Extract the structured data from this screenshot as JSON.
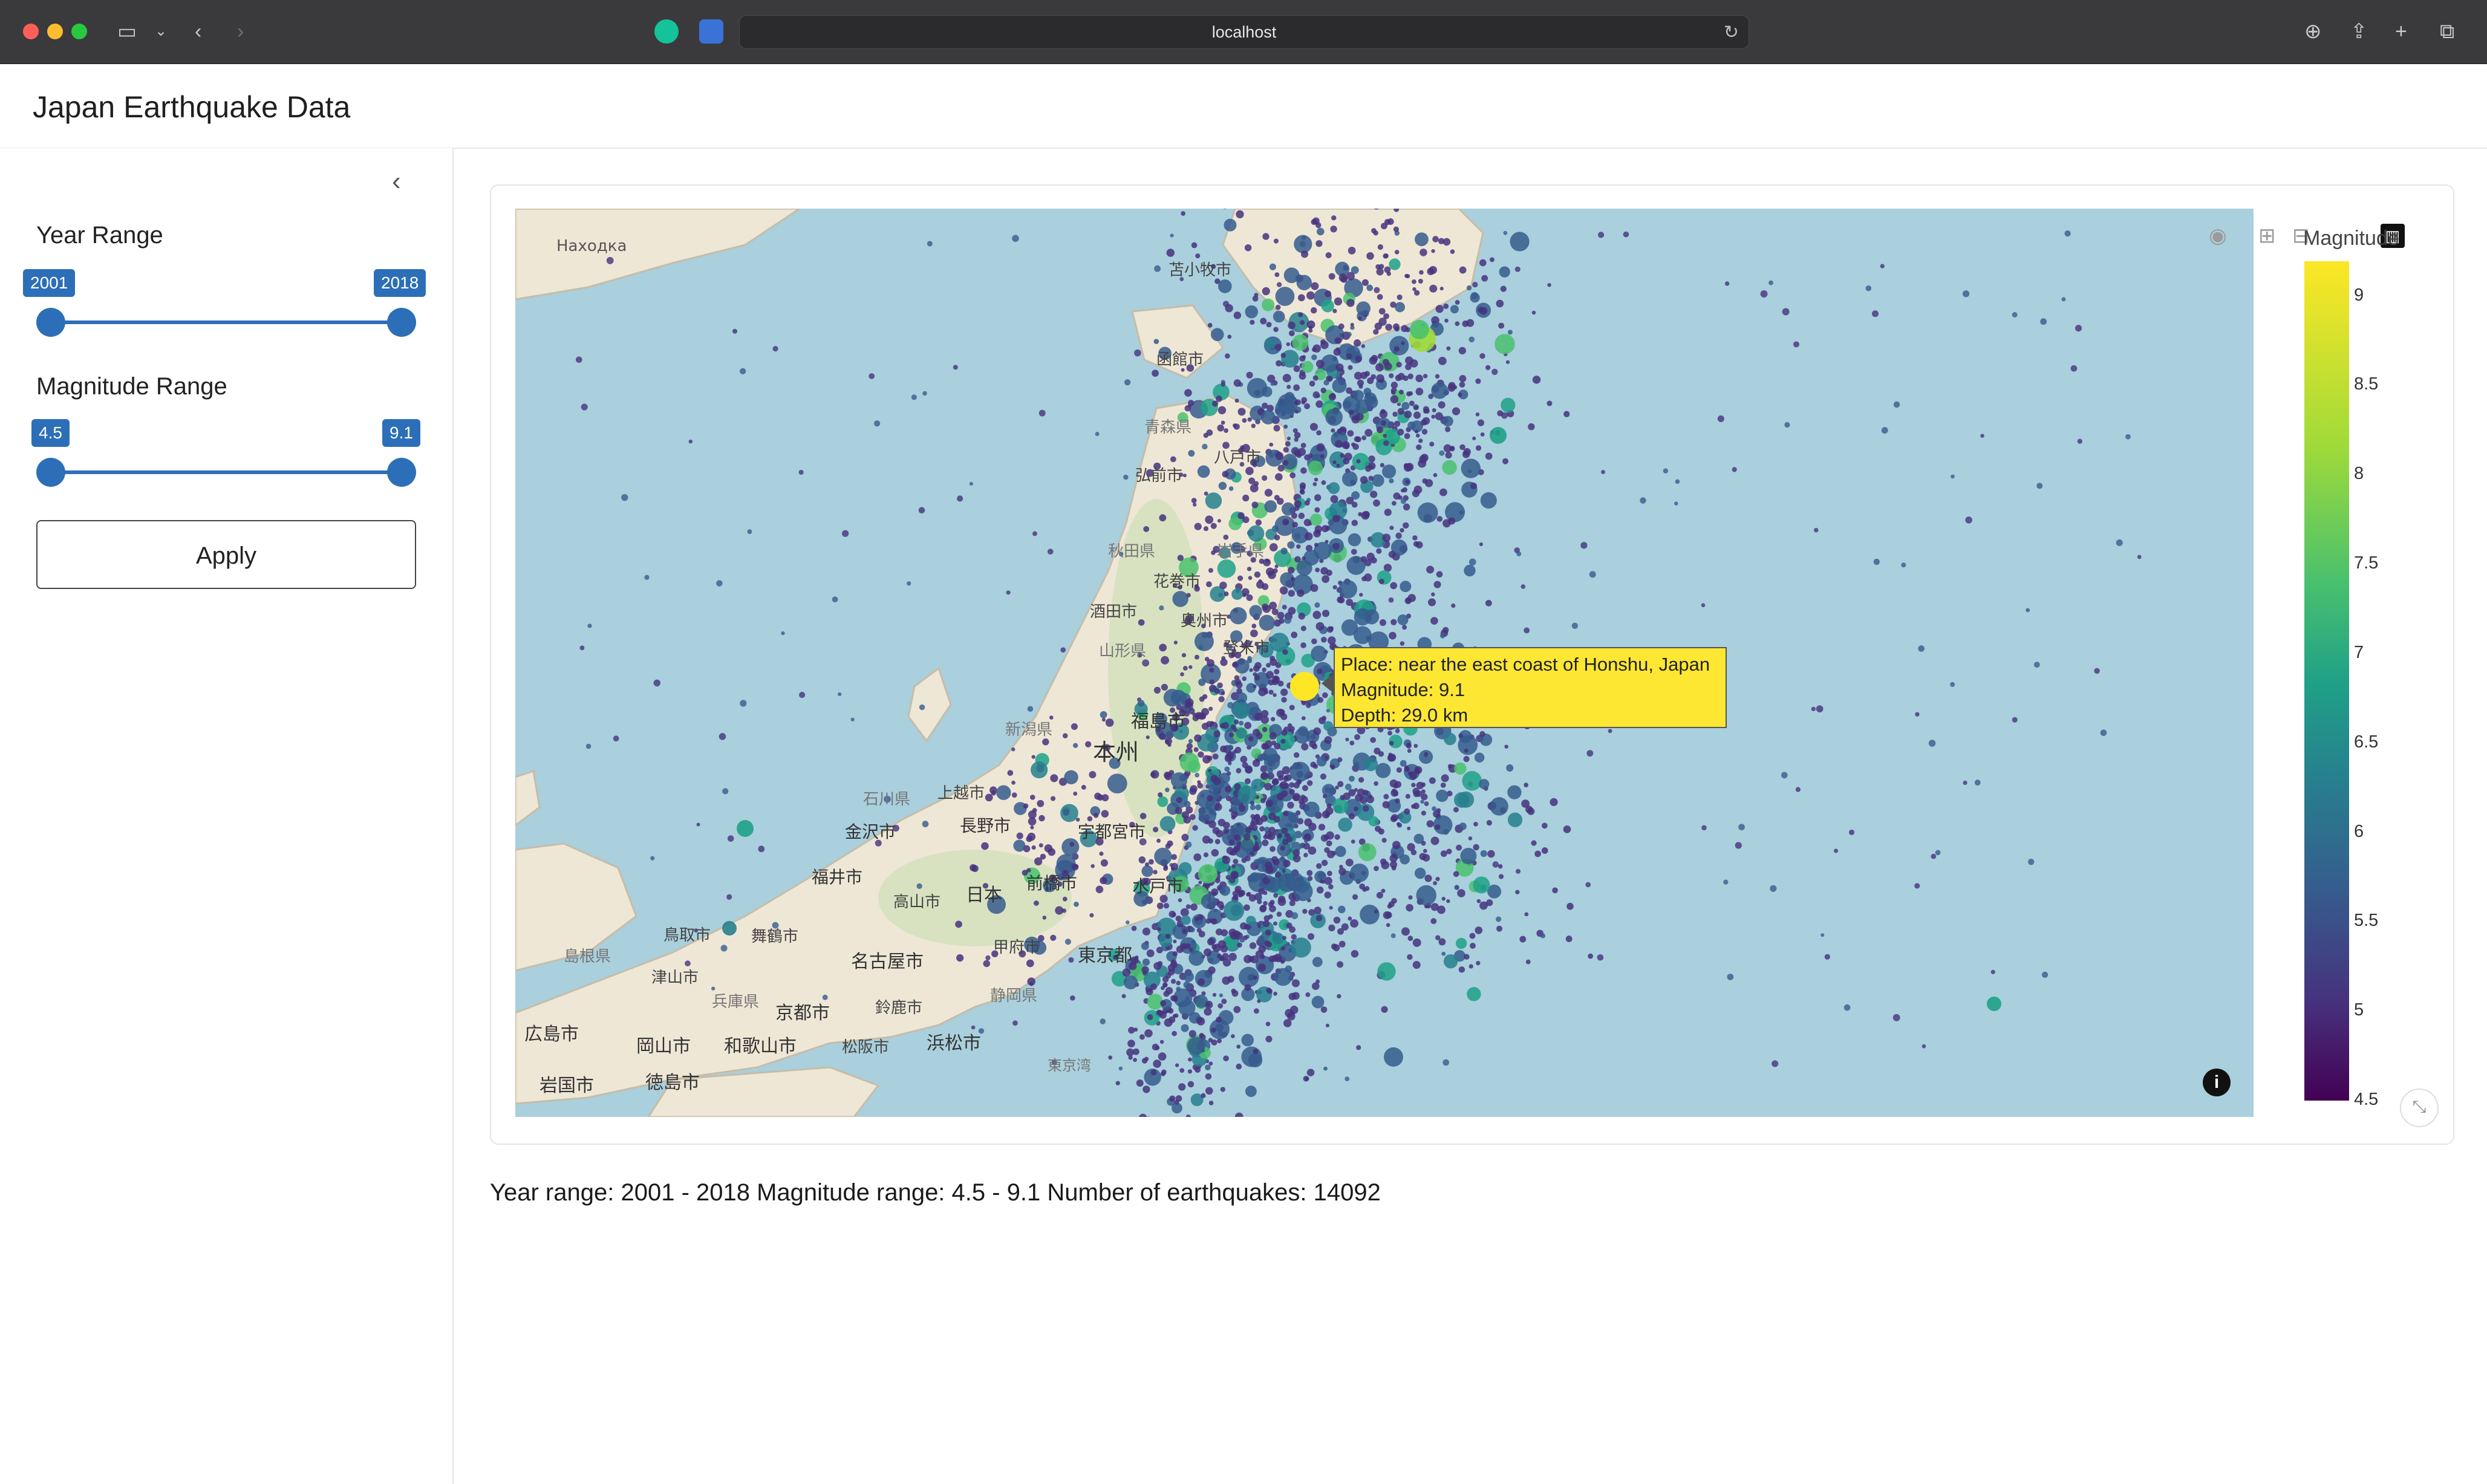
{
  "browser": {
    "url": "localhost",
    "colors": {
      "close": "#ff5f57",
      "minimize": "#febc2e",
      "zoom": "#28c840"
    }
  },
  "app": {
    "title": "Japan Earthquake Data"
  },
  "sidebar": {
    "year_label": "Year Range",
    "year_min": "2001",
    "year_max": "2018",
    "mag_label": "Magnitude Range",
    "mag_min": "4.5",
    "mag_max": "9.1",
    "apply_label": "Apply"
  },
  "map": {
    "labels": {
      "nakhodka": "Находка",
      "tomakomai": "苫小牧市",
      "hakodate": "函館市",
      "aomori": "青森県",
      "hachinohe": "八戸市",
      "hirosaki": "弘前市",
      "akita": "秋田県",
      "iwate": "岩手県",
      "hanamaki": "花巻市",
      "sakata": "酒田市",
      "oshu": "奥州市",
      "yamagata": "山形県",
      "tome": "登米市",
      "niigata": "新潟県",
      "fukushima": "福島市",
      "honshu": "本州",
      "ishikawa": "石川県",
      "joetsu": "上越市",
      "nagano": "長野市",
      "kanazawa": "金沢市",
      "utsunomiya": "宇都宮市",
      "fukui": "福井市",
      "takayama": "高山市",
      "nihon": "日本",
      "maebashi": "前橋市",
      "mito": "水戸市",
      "tottori": "鳥取市",
      "maizuru": "舞鶴市",
      "kofu": "甲府市",
      "tokyo_to": "東京都",
      "shimane": "島根県",
      "tsuyama": "津山市",
      "nagoya": "名古屋市",
      "hyogo": "兵庫県",
      "kyoto": "京都市",
      "suzuka": "鈴鹿市",
      "shizuoka": "静岡県",
      "hiroshima": "広島市",
      "okayama": "岡山市",
      "wakayama": "和歌山市",
      "matsusaka": "松阪市",
      "hamamatsu": "浜松市",
      "tokyo_bay": "東京湾",
      "iwakuni": "岩国市",
      "tokushima": "徳島市"
    },
    "tooltip": {
      "place": "Place: near the east coast of Honshu, Japan",
      "magnitude": "Magnitude: 9.1",
      "depth": "Depth: 29.0 km"
    }
  },
  "chart_data": {
    "type": "scatter",
    "colorbar": {
      "title": "Magnitude",
      "ticks": [
        "9",
        "8.5",
        "8",
        "7.5",
        "7",
        "6.5",
        "6",
        "5.5",
        "5",
        "4.5"
      ],
      "range": [
        4.5,
        9.1
      ]
    },
    "highlight": {
      "magnitude": 9.1,
      "depth_km": 29.0,
      "place": "near the east coast of Honshu, Japan"
    }
  },
  "summary": "Year range: 2001 - 2018 Magnitude range: 4.5 - 9.1 Number of earthquakes: 14092"
}
